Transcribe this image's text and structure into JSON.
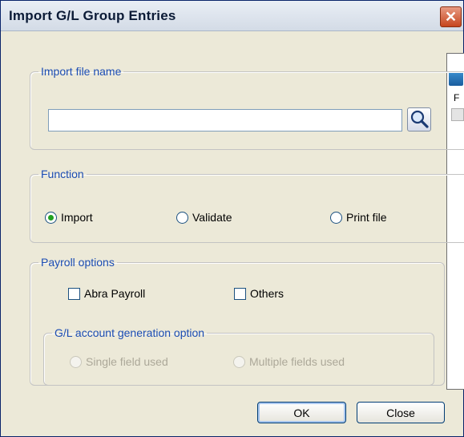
{
  "window": {
    "title": "Import G/L Group Entries",
    "close_glyph": "✕"
  },
  "file_group": {
    "legend": "Import file name",
    "file_input": {
      "value": "",
      "placeholder": ""
    },
    "search_icon": "magnifier-icon"
  },
  "function_group": {
    "legend": "Function",
    "options": [
      {
        "label": "Import",
        "checked": true
      },
      {
        "label": "Validate",
        "checked": false
      },
      {
        "label": "Print file",
        "checked": false
      }
    ]
  },
  "payroll_group": {
    "legend": "Payroll options",
    "checkboxes": [
      {
        "label": "Abra Payroll",
        "checked": false
      },
      {
        "label": "Others",
        "checked": false
      }
    ],
    "gl_generation": {
      "legend": "G/L account generation option",
      "options": [
        {
          "label": "Single field used",
          "enabled": false
        },
        {
          "label": "Multiple fields used",
          "enabled": false
        }
      ]
    }
  },
  "buttons": {
    "ok": "OK",
    "close": "Close"
  },
  "background_window": {
    "text": "F"
  },
  "colors": {
    "legend": "#1c4db3",
    "window_bg": "#ece9d8",
    "close_button": "#c6451d",
    "radio_checked": "#21a121"
  }
}
